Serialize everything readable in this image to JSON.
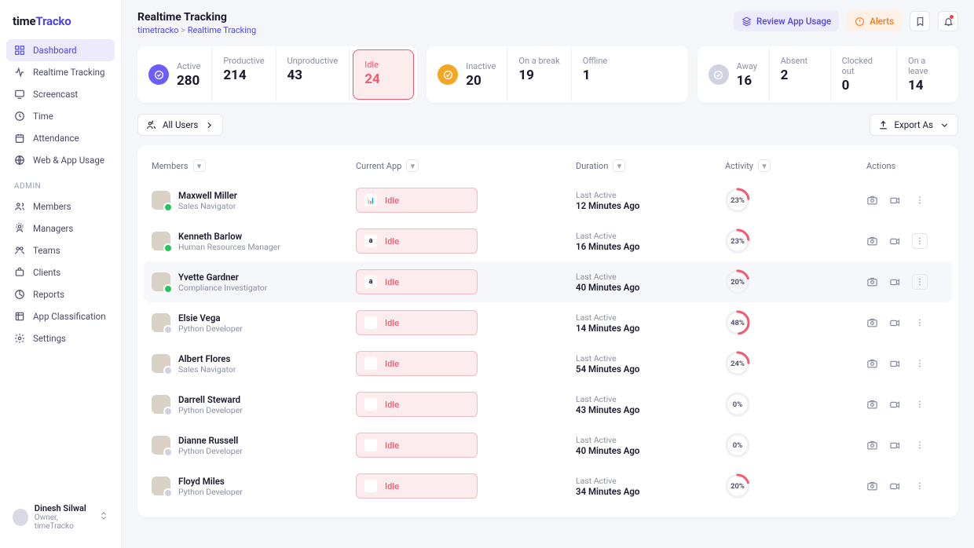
{
  "brand": {
    "a": "time",
    "b": "Tracko"
  },
  "nav": {
    "items": [
      {
        "label": "Dashboard"
      },
      {
        "label": "Realtime Tracking"
      },
      {
        "label": "Screencast"
      },
      {
        "label": "Time"
      },
      {
        "label": "Attendance"
      },
      {
        "label": "Web & App Usage"
      }
    ],
    "adminLabel": "ADMIN",
    "admin": [
      {
        "label": "Members"
      },
      {
        "label": "Managers"
      },
      {
        "label": "Teams"
      },
      {
        "label": "Clients"
      },
      {
        "label": "Reports"
      },
      {
        "label": "App Classification"
      },
      {
        "label": "Settings"
      }
    ]
  },
  "footer": {
    "name": "Dinesh Silwal",
    "role": "Owner, timeTracko"
  },
  "page": {
    "title": "Realtime Tracking",
    "crumbRoot": "timetracko",
    "crumbSep": ">",
    "crumbLeaf": "Realtime Tracking"
  },
  "actions": {
    "review": "Review App Usage",
    "alerts": "Alerts"
  },
  "stats": {
    "g1": [
      {
        "label": "Active",
        "value": "280",
        "icon": "purple"
      },
      {
        "label": "Productive",
        "value": "214"
      },
      {
        "label": "Unproductive",
        "value": "43"
      },
      {
        "label": "Idle",
        "value": "24",
        "highlight": true
      }
    ],
    "g2": [
      {
        "label": "Inactive",
        "value": "20",
        "icon": "orange"
      },
      {
        "label": "On a break",
        "value": "19"
      },
      {
        "label": "Offline",
        "value": "1"
      }
    ],
    "g3": [
      {
        "label": "Away",
        "value": "16",
        "icon": "gray"
      },
      {
        "label": "Absent",
        "value": "2"
      },
      {
        "label": "Clocked out",
        "value": "0"
      },
      {
        "label": "On a leave",
        "value": "14"
      }
    ]
  },
  "filter": {
    "allUsers": "All Users",
    "export": "Export As"
  },
  "table": {
    "headers": {
      "members": "Members",
      "app": "Current App",
      "duration": "Duration",
      "activity": "Activity",
      "actions": "Actions"
    },
    "lastActive": "Last Active",
    "idle": "Idle",
    "rows": [
      {
        "name": "Maxwell Miller",
        "role": "Sales Navigator",
        "appIcon": "ga",
        "duration": "12 Minutes Ago",
        "activity": 23,
        "dot": "green",
        "sel": false,
        "kebabBox": false
      },
      {
        "name": "Kenneth Barlow",
        "role": "Human Resources Manager",
        "appIcon": "amz",
        "duration": "16 Minutes Ago",
        "activity": 23,
        "dot": "green",
        "sel": false,
        "kebabBox": true
      },
      {
        "name": "Yvette Gardner",
        "role": "Compliance Investigator",
        "appIcon": "amz",
        "duration": "40 Minutes Ago",
        "activity": 20,
        "dot": "green",
        "sel": true,
        "kebabBox": true
      },
      {
        "name": "Elsie Vega",
        "role": "Python Developer",
        "appIcon": "",
        "duration": "14 Minutes Ago",
        "activity": 48,
        "dot": "gray",
        "sel": false,
        "kebabBox": false
      },
      {
        "name": "Albert Flores",
        "role": "Sales Navigator",
        "appIcon": "",
        "duration": "54 Minutes Ago",
        "activity": 24,
        "dot": "gray",
        "sel": false,
        "kebabBox": false
      },
      {
        "name": "Darrell Steward",
        "role": "Python Developer",
        "appIcon": "",
        "duration": "43 Minutes Ago",
        "activity": 0,
        "dot": "gray",
        "sel": false,
        "kebabBox": false
      },
      {
        "name": "Dianne Russell",
        "role": "Python Developer",
        "appIcon": "",
        "duration": "40 Minutes Ago",
        "activity": 0,
        "dot": "gray",
        "sel": false,
        "kebabBox": false
      },
      {
        "name": "Floyd Miles",
        "role": "Python Developer",
        "appIcon": "",
        "duration": "34 Minutes Ago",
        "activity": 20,
        "dot": "gray",
        "sel": false,
        "kebabBox": false
      }
    ]
  }
}
